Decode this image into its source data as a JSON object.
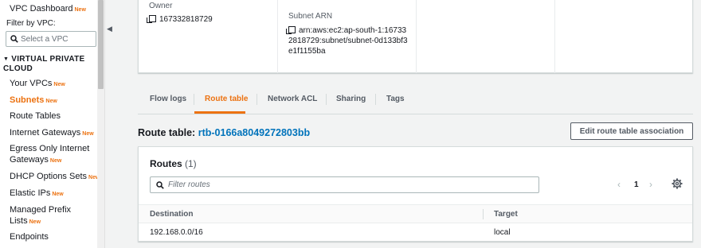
{
  "sidebar": {
    "vpc_dashboard": "VPC Dashboard",
    "filter_label": "Filter by VPC:",
    "vpc_select_placeholder": "Select a VPC",
    "section_title": "VIRTUAL PRIVATE CLOUD",
    "new_badge": "New",
    "items": [
      {
        "label": "Your VPCs",
        "new": true
      },
      {
        "label": "Subnets",
        "new": true,
        "active": true
      },
      {
        "label": "Route Tables",
        "new": false
      },
      {
        "label": "Internet Gateways",
        "new": true
      },
      {
        "label": "Egress Only Internet Gateways",
        "new": true
      },
      {
        "label": "DHCP Options Sets",
        "new": true
      },
      {
        "label": "Elastic IPs",
        "new": true
      },
      {
        "label": "Managed Prefix Lists",
        "new": true
      },
      {
        "label": "Endpoints",
        "new": false
      }
    ],
    "collapse_icon": "chevron-left-icon"
  },
  "details": {
    "owner_label": "Owner",
    "owner_value": "167332818729",
    "subnet_arn_label": "Subnet ARN",
    "subnet_arn_value": "arn:aws:ec2:ap-south-1:167332818729:subnet/subnet-0d133bf3e1f1155ba"
  },
  "tabs": [
    {
      "label": "Flow logs",
      "active": false
    },
    {
      "label": "Route table",
      "active": true
    },
    {
      "label": "Network ACL",
      "active": false
    },
    {
      "label": "Sharing",
      "active": false
    },
    {
      "label": "Tags",
      "active": false
    }
  ],
  "route_table": {
    "title_prefix": "Route table:",
    "id": "rtb-0166a8049272803bb",
    "edit_button": "Edit route table association"
  },
  "routes": {
    "heading": "Routes",
    "count": "(1)",
    "filter_placeholder": "Filter routes",
    "page": "1",
    "columns": [
      "Destination",
      "Target"
    ],
    "rows": [
      {
        "destination": "192.168.0.0/16",
        "target": "local"
      }
    ]
  },
  "colors": {
    "accent": "#ec7211",
    "link": "#0073bb",
    "text": "#16191f",
    "muted": "#545b64"
  }
}
